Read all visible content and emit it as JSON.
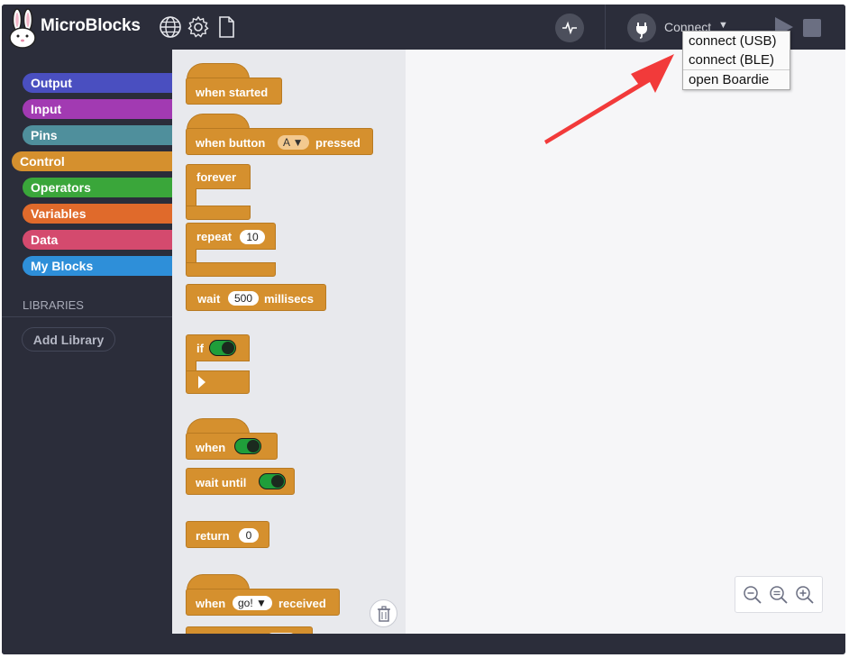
{
  "app": {
    "title": "MicroBlocks"
  },
  "topbar": {
    "connect_label": "Connect",
    "connect_arrow": "▼"
  },
  "categories": [
    {
      "label": "Output",
      "color": "#4a4fc0"
    },
    {
      "label": "Input",
      "color": "#a23ab2"
    },
    {
      "label": "Pins",
      "color": "#4f8f9c"
    },
    {
      "label": "Control",
      "color": "#d5902e"
    },
    {
      "label": "Operators",
      "color": "#3aa63a"
    },
    {
      "label": "Variables",
      "color": "#e06a2b"
    },
    {
      "label": "Data",
      "color": "#d44a6e"
    },
    {
      "label": "My Blocks",
      "color": "#2e8fd9"
    }
  ],
  "libraries": {
    "heading": "LIBRARIES",
    "add_label": "Add Library"
  },
  "blocks": {
    "when_started": "when started",
    "when_button_pre": "when button",
    "when_button_value": "A",
    "when_button_post": "pressed",
    "forever": "forever",
    "repeat": "repeat",
    "repeat_value": "10",
    "wait": "wait",
    "wait_value": "500",
    "wait_unit": "millisecs",
    "if": "if",
    "when": "when",
    "wait_until": "wait until",
    "return": "return",
    "return_value": "0",
    "when_recv_pre": "when",
    "when_recv_value": "go!",
    "when_recv_post": "received"
  },
  "connect_menu": {
    "items": [
      "connect (USB)",
      "connect (BLE)",
      "open Boardie"
    ]
  },
  "annotation": {
    "color": "#f23a3a"
  }
}
